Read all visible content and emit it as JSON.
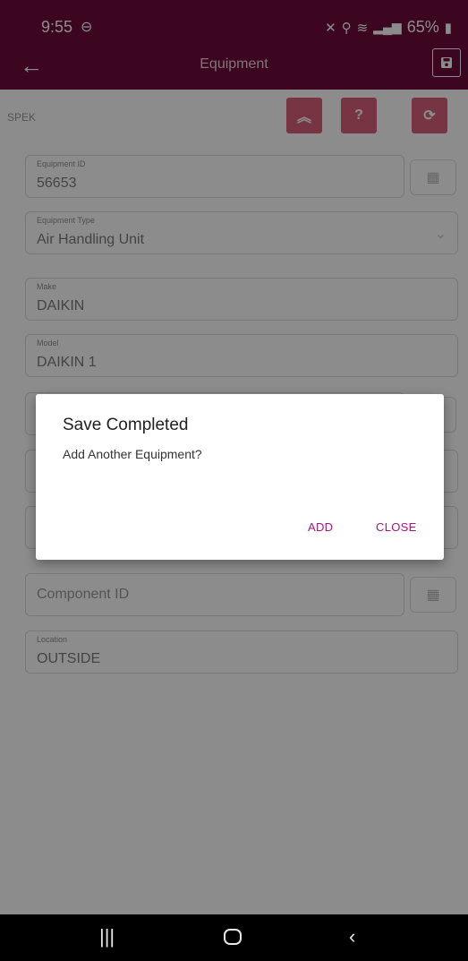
{
  "status_bar": {
    "time": "9:55",
    "battery": "65%"
  },
  "app_bar": {
    "title": "Equipment"
  },
  "form": {
    "top_label": "SPEK",
    "help_label": "?",
    "fields": [
      {
        "label": "Equipment ID",
        "value": "56653"
      },
      {
        "label": "Equipment Type",
        "value": "Air Handling Unit"
      },
      {
        "label": "Make",
        "value": "DAIKIN"
      },
      {
        "label": "Model",
        "value": "DAIKIN 1"
      },
      {
        "label": "Location",
        "value": "OUTSIDE"
      }
    ],
    "component_id_placeholder": "Component ID"
  },
  "dialog": {
    "title": "Save Completed",
    "message": "Add Another Equipment?",
    "add_label": "ADD",
    "close_label": "CLOSE"
  },
  "colors": {
    "primary": "#6d0a3b",
    "accent": "#a3157d",
    "pink": "#d9627a"
  }
}
